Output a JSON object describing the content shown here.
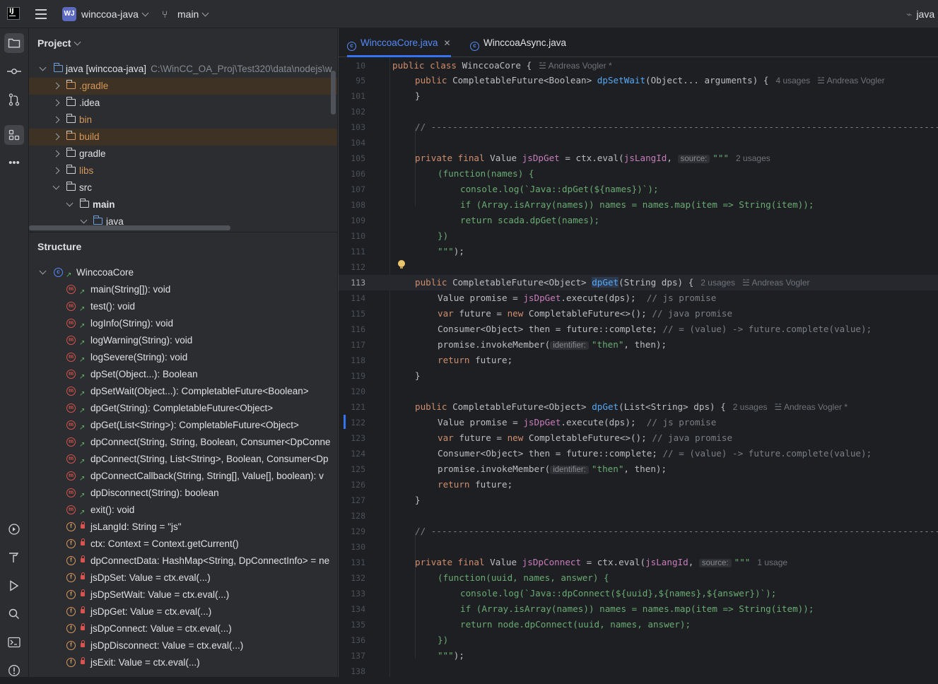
{
  "topbar": {
    "logo": "IJ",
    "project_badge": "WJ",
    "project_name": "winccoa-java",
    "branch": "main",
    "right_text": "java"
  },
  "sidebar_icons": [
    "folder-icon",
    "commit-icon",
    "pull-requests-icon",
    "structure-icon",
    "more-icon"
  ],
  "sidebar_bottom_icons": [
    "services-icon",
    "build-icon",
    "run-icon",
    "search-icon",
    "terminal-icon",
    "problems-icon"
  ],
  "project": {
    "title": "Project",
    "root_label": "java [winccoa-java]",
    "root_path": "C:\\WinCC_OA_Proj\\Test320\\data\\nodejs\\w",
    "items": [
      {
        "label": ".gradle",
        "excluded": true
      },
      {
        "label": ".idea",
        "excluded": false
      },
      {
        "label": "bin",
        "excluded": true
      },
      {
        "label": "build",
        "excluded": true
      },
      {
        "label": "gradle",
        "excluded": false
      },
      {
        "label": "libs",
        "excluded": true
      },
      {
        "label": "src",
        "excluded": false
      },
      {
        "label": "main",
        "excluded": false
      },
      {
        "label": "java",
        "excluded": false
      }
    ]
  },
  "structure": {
    "title": "Structure",
    "class_name": "WinccoaCore",
    "members": [
      {
        "kind": "method",
        "label": "main(String[]): void"
      },
      {
        "kind": "method",
        "label": "test(): void"
      },
      {
        "kind": "method",
        "label": "logInfo(String): void"
      },
      {
        "kind": "method",
        "label": "logWarning(String): void"
      },
      {
        "kind": "method",
        "label": "logSevere(String): void"
      },
      {
        "kind": "method",
        "label": "dpSet(Object...): Boolean"
      },
      {
        "kind": "method",
        "label": "dpSetWait(Object...): CompletableFuture<Boolean>"
      },
      {
        "kind": "method",
        "label": "dpGet(String): CompletableFuture<Object>"
      },
      {
        "kind": "method",
        "label": "dpGet(List<String>): CompletableFuture<Object>"
      },
      {
        "kind": "method",
        "label": "dpConnect(String, String, Boolean, Consumer<DpConne"
      },
      {
        "kind": "method",
        "label": "dpConnect(String, List<String>, Boolean, Consumer<Dp"
      },
      {
        "kind": "method",
        "label": "dpConnectCallback(String, String[], Value[], boolean): v"
      },
      {
        "kind": "method",
        "label": "dpDisconnect(String): boolean"
      },
      {
        "kind": "method",
        "label": "exit(): void"
      },
      {
        "kind": "field",
        "label": "jsLangId: String = \"js\""
      },
      {
        "kind": "field",
        "label": "ctx: Context = Context.getCurrent()"
      },
      {
        "kind": "field",
        "label": "dpConnectData: HashMap<String, DpConnectInfo> = ne"
      },
      {
        "kind": "field",
        "label": "jsDpSet: Value = ctx.eval(...)"
      },
      {
        "kind": "field",
        "label": "jsDpSetWait: Value = ctx.eval(...)"
      },
      {
        "kind": "field",
        "label": "jsDpGet: Value = ctx.eval(...)"
      },
      {
        "kind": "field",
        "label": "jsDpConnect: Value = ctx.eval(...)"
      },
      {
        "kind": "field",
        "label": "jsDpDisconnect: Value = ctx.eval(...)"
      },
      {
        "kind": "field",
        "label": "jsExit: Value = ctx.eval(...)"
      }
    ]
  },
  "editor": {
    "tabs": [
      {
        "label": "WinccoaCore.java",
        "active": true,
        "close": "✕"
      },
      {
        "label": "WinccoaAsync.java",
        "active": false
      }
    ],
    "current_line": "113",
    "lines": {
      "l10": {
        "n": "10",
        "code": "public class WinccoaCore {",
        "hint": "Andreas Vogler *"
      },
      "l95": {
        "n": "95",
        "code_a": "public CompletableFuture<Boolean> ",
        "fn": "dpSetWait",
        "code_b": "(Object... arguments) {",
        "usages": "4 usages",
        "author": "Andreas Vogler"
      },
      "l101": {
        "n": "101",
        "code": "}"
      },
      "l102": {
        "n": "102"
      },
      "l103": {
        "n": "103",
        "code": "// ----------------------------------------------------------------------------------------------------"
      },
      "l104": {
        "n": "104"
      },
      "l105": {
        "n": "105",
        "code_a": "private final Value ",
        "fld": "jsDpGet",
        "code_b": " = ctx.eval(jsLangId, ",
        "inlay": "source:",
        "str": "\"\"\"",
        "usages": "2 usages"
      },
      "l106": {
        "n": "106",
        "code": "(function(names) {"
      },
      "l107": {
        "n": "107",
        "code": "console.log(`Java::dpGet(${names})`);"
      },
      "l108": {
        "n": "108",
        "code": "if (Array.isArray(names)) names = names.map(item => String(item));"
      },
      "l109": {
        "n": "109",
        "code": "return scada.dpGet(names);"
      },
      "l110": {
        "n": "110",
        "code": "})"
      },
      "l111": {
        "n": "111",
        "str": "\"\"\"",
        "code": ");"
      },
      "l112": {
        "n": "112"
      },
      "l113": {
        "n": "113",
        "code_a": "public CompletableFuture<Object> ",
        "fn": "dpGet",
        "code_b": "(String dps) {",
        "usages": "2 usages",
        "author": "Andreas Vogler"
      },
      "l114": {
        "n": "114",
        "code_a": "Value promise = ",
        "fld": "jsDpGet",
        "code_b": ".execute(dps);  ",
        "cm": "// js promise"
      },
      "l115": {
        "n": "115",
        "kw": "var",
        "code_a": " future = ",
        "kw2": "new",
        "code_b": " CompletableFuture<>(); ",
        "cm": "// java promise"
      },
      "l116": {
        "n": "116",
        "code_a": "Consumer<Object> then = future::complete; ",
        "cm": "// = (value) -> future.complete(value);"
      },
      "l117": {
        "n": "117",
        "code_a": "promise.invokeMember(",
        "inlay": "identifier:",
        "str": "\"then\"",
        "code_b": ", then);"
      },
      "l118": {
        "n": "118",
        "kw": "return",
        "code_a": " future;"
      },
      "l119": {
        "n": "119",
        "code": "}"
      },
      "l120": {
        "n": "120"
      },
      "l121": {
        "n": "121",
        "code_a": "public CompletableFuture<Object> ",
        "fn": "dpGet",
        "code_b": "(List<String> dps) {",
        "usages": "2 usages",
        "author": "Andreas Vogler *"
      },
      "l122": {
        "n": "122",
        "code_a": "Value promise = ",
        "fld": "jsDpGet",
        "code_b": ".execute(dps);  ",
        "cm": "// js promise"
      },
      "l123": {
        "n": "123",
        "kw": "var",
        "code_a": " future = ",
        "kw2": "new",
        "code_b": " CompletableFuture<>(); ",
        "cm": "// java promise"
      },
      "l124": {
        "n": "124",
        "code_a": "Consumer<Object> then = future::complete; ",
        "cm": "// = (value) -> future.complete(value);"
      },
      "l125": {
        "n": "125",
        "code_a": "promise.invokeMember(",
        "inlay": "identifier:",
        "str": "\"then\"",
        "code_b": ", then);"
      },
      "l126": {
        "n": "126",
        "kw": "return",
        "code_a": " future;"
      },
      "l127": {
        "n": "127",
        "code": "}"
      },
      "l128": {
        "n": "128"
      },
      "l129": {
        "n": "129",
        "code": "// ----------------------------------------------------------------------------------------------------"
      },
      "l130": {
        "n": "130"
      },
      "l131": {
        "n": "131",
        "code_a": "private final Value ",
        "fld": "jsDpConnect",
        "code_b": " = ctx.eval(jsLangId, ",
        "inlay": "source:",
        "str": "\"\"\"",
        "usages": "1 usage"
      },
      "l132": {
        "n": "132",
        "code": "(function(uuid, names, answer) {"
      },
      "l133": {
        "n": "133",
        "code": "console.log(`Java::dpConnect(${uuid},${names},${answer})`);"
      },
      "l134": {
        "n": "134",
        "code": "if (Array.isArray(names)) names = names.map(item => String(item));"
      },
      "l135": {
        "n": "135",
        "code": "return node.dpConnect(uuid, names, answer);"
      },
      "l136": {
        "n": "136",
        "code": "})"
      },
      "l137": {
        "n": "137",
        "str": "\"\"\"",
        "code": ");"
      },
      "l138": {
        "n": "138"
      }
    }
  }
}
